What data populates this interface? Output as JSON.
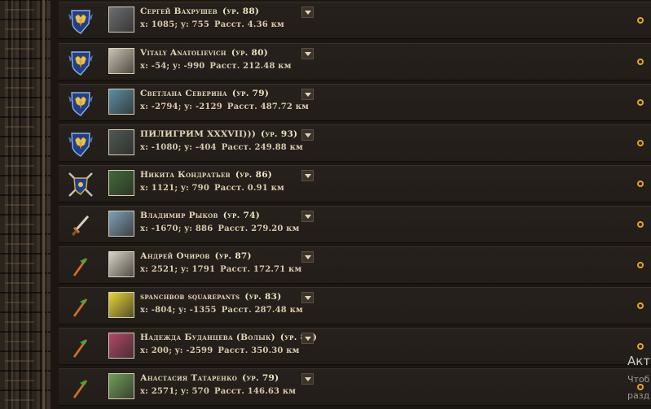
{
  "players": [
    {
      "name": "Сергей Вахрушев",
      "level": "(ур. 88)",
      "coords": "x: 1085; y: 755",
      "dist": "Расст. 4.36 км",
      "rank": "shield-bird-icon",
      "avatar_color": "#6b6f74"
    },
    {
      "name": "Vitaly Anatolievich",
      "level": "(ур. 80)",
      "coords": "x: -54; y: -990",
      "dist": "Расст. 212.48 км",
      "rank": "shield-bird-icon",
      "avatar_color": "#c9c2b4"
    },
    {
      "name": "Светлана Северина",
      "level": "(ур. 79)",
      "coords": "x: -2794; y: -2129",
      "dist": "Расст. 487.72 км",
      "rank": "shield-bird-icon",
      "avatar_color": "#5b8ea6"
    },
    {
      "name": "ПИЛИГРИМ XXXVII)))",
      "level": "(ур. 93)",
      "coords": "x: -1080; y: -404",
      "dist": "Расст. 249.88 км",
      "rank": "shield-bird-icon",
      "avatar_color": "#4d5a55"
    },
    {
      "name": "Никита Кондратьев",
      "level": "(ур. 86)",
      "coords": "x: 1121; y: 790",
      "dist": "Расст. 0.91 км",
      "rank": "crossed-swords-shield-icon",
      "avatar_color": "#3f6b3a"
    },
    {
      "name": "Владимир Рыков",
      "level": "(ур. 74)",
      "coords": "x: -1670; y: 886",
      "dist": "Расст. 279.20 км",
      "rank": "dagger-icon",
      "avatar_color": "#7fa0b8"
    },
    {
      "name": "Андрей Очиров",
      "level": "(ур. 87)",
      "coords": "x: 2521; y: 1791",
      "dist": "Расст. 172.71 км",
      "rank": "staff-icon",
      "avatar_color": "#d8d4c8"
    },
    {
      "name": "spanchbob squarepants",
      "level": "(ур. 83)",
      "coords": "x: -804; y: -1355",
      "dist": "Расст. 287.48 км",
      "rank": "staff-icon",
      "avatar_color": "#e6d63a"
    },
    {
      "name": "Надежда Буданцева (Волык)",
      "level": "(ур. 81)",
      "coords": "x: 200; y: -2599",
      "dist": "Расст. 350.30 км",
      "rank": "staff-icon",
      "avatar_color": "#b04a6a"
    },
    {
      "name": "Анастасия Татаренко",
      "level": "(ур. 79)",
      "coords": "x: 2571; y: 570",
      "dist": "Расст. 146.63 км",
      "rank": "staff-icon",
      "avatar_color": "#6f9e5a"
    }
  ],
  "colors": {
    "accent": "#e1a820",
    "text": "#e3d5b8",
    "row_bg": "#26211c"
  },
  "watermark": {
    "line1": "Акт",
    "line2": "Чтоб",
    "line3": "разд"
  }
}
